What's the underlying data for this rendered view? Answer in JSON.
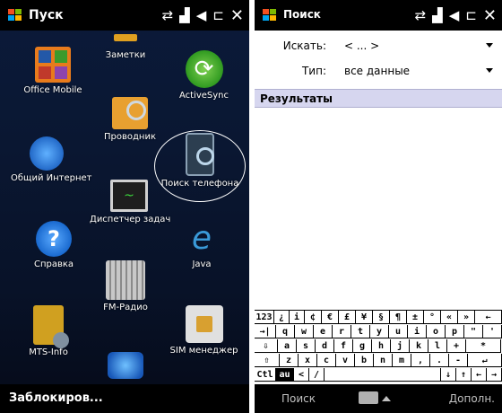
{
  "left_screen": {
    "title": "Пуск",
    "bottom_label": "Заблокиров...",
    "tiles": [
      {
        "label": "Заметки",
        "icon": "notes-icon"
      },
      {
        "label": "Office Mobile",
        "icon": "office-mobile-icon"
      },
      {
        "label": "ActiveSync",
        "icon": "activesync-icon"
      },
      {
        "label": "Проводник",
        "icon": "explorer-icon"
      },
      {
        "label": "Общий Интернет",
        "icon": "internet-sharing-icon"
      },
      {
        "label": "Поиск телефона",
        "icon": "phone-search-icon"
      },
      {
        "label": "Диспетчер задач",
        "icon": "task-manager-icon"
      },
      {
        "label": "Справка",
        "icon": "help-icon"
      },
      {
        "label": "Java",
        "icon": "java-icon"
      },
      {
        "label": "FM-Радио",
        "icon": "fm-radio-icon"
      },
      {
        "label": "MTS-Info",
        "icon": "mts-info-icon"
      },
      {
        "label": "SIM менеджер",
        "icon": "sim-manager-icon"
      }
    ]
  },
  "right_screen": {
    "title": "Поиск",
    "search_label": "Искать:",
    "search_value": "< ... >",
    "type_label": "Тип:",
    "type_value": "все данные",
    "results_header": "Результаты",
    "softkey_left": "Поиск",
    "softkey_right": "Дополн."
  },
  "keyboard": {
    "row1": [
      "123",
      "¿",
      "i",
      "¢",
      "€",
      "£",
      "¥",
      "§",
      "¶",
      "±",
      "°",
      "«",
      "»",
      "←"
    ],
    "row2": [
      "→|",
      "q",
      "w",
      "e",
      "r",
      "t",
      "y",
      "u",
      "i",
      "o",
      "p",
      "\"",
      "'"
    ],
    "row3": [
      "⇩",
      "a",
      "s",
      "d",
      "f",
      "g",
      "h",
      "j",
      "k",
      "l",
      "+",
      "*"
    ],
    "row4": [
      "⇧",
      "z",
      "x",
      "c",
      "v",
      "b",
      "n",
      "m",
      ",",
      ".",
      "-",
      "↵"
    ],
    "row5": [
      "Ctl",
      "au",
      "<",
      "/",
      "",
      "↓",
      "↑",
      "←",
      "→"
    ]
  },
  "colors": {
    "accent_header": "#d6d6ef",
    "topbar": "#000000"
  }
}
